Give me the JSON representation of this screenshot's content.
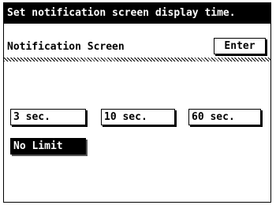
{
  "header": {
    "text": "Set notification screen display time."
  },
  "panel": {
    "title": "Notification Screen",
    "enter_label": "Enter"
  },
  "options": [
    "3 sec.",
    "10 sec.",
    "60 sec.",
    "No Limit"
  ],
  "selected": "No Limit"
}
